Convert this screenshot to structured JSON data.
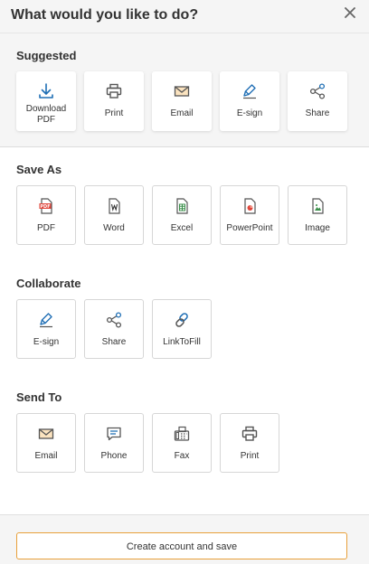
{
  "header": {
    "title": "What would you like to do?"
  },
  "sections": {
    "suggested": {
      "title": "Suggested",
      "items": [
        "Download\nPDF",
        "Print",
        "Email",
        "E-sign",
        "Share"
      ]
    },
    "save_as": {
      "title": "Save As",
      "items": [
        "PDF",
        "Word",
        "Excel",
        "PowerPoint",
        "Image"
      ]
    },
    "collaborate": {
      "title": "Collaborate",
      "items": [
        "E-sign",
        "Share",
        "LinkToFill"
      ]
    },
    "send_to": {
      "title": "Send To",
      "items": [
        "Email",
        "Phone",
        "Fax",
        "Print"
      ]
    }
  },
  "footer": {
    "cta": "Create account and save"
  },
  "colors": {
    "accent_blue": "#1f6fb5",
    "button_border": "#e8a03a",
    "pdf_red": "#e0453a",
    "excel_green": "#3a8f4a"
  },
  "icons": {
    "download": "download-icon",
    "print": "printer-icon",
    "email": "envelope-icon",
    "esign": "pen-icon",
    "share": "share-icon",
    "pdf": "pdf-file-icon",
    "word": "word-file-icon",
    "excel": "excel-file-icon",
    "powerpoint": "powerpoint-file-icon",
    "image": "image-file-icon",
    "link": "link-icon",
    "phone": "chat-icon",
    "fax": "fax-icon",
    "close": "close-icon"
  }
}
